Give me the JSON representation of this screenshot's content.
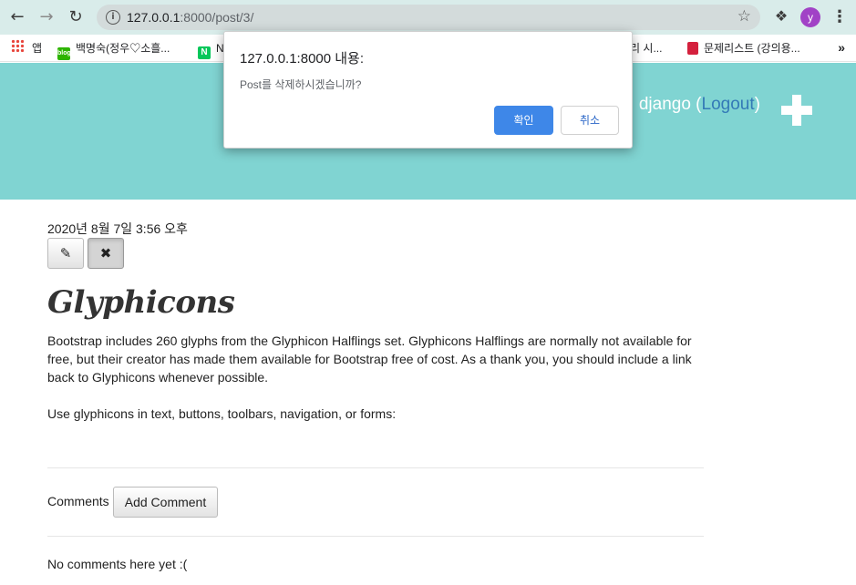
{
  "browser": {
    "url_host": "127.0.0.1",
    "url_rest": ":8000/post/3/",
    "profile_initial": "y",
    "bookmarks": [
      {
        "label": "앱",
        "icon": "apps-grid-icon"
      },
      {
        "label": "백명숙(정우♡소흘...",
        "icon": "blog-icon"
      },
      {
        "label": "N",
        "icon": "naver-icon"
      },
      {
        "label": "관리 시...",
        "icon": ""
      },
      {
        "label": "문제리스트 (강의용...",
        "icon": "book-icon"
      }
    ]
  },
  "header": {
    "greeting": "!, django (",
    "logout": "Logout",
    "greeting_end": ")",
    "accent_color": "#80d4d2"
  },
  "post": {
    "date": "2020년 8월 7일 3:56 오후",
    "title": "Glyphicons",
    "paragraph1": "Bootstrap includes 260 glyphs from the Glyphicon Halflings set. Glyphicons Halflings are normally not available for free, but their creator has made them available for Bootstrap free of cost. As a thank you, you should include a link back to Glyphicons whenever possible.",
    "paragraph2": "Use glyphicons in text, buttons, toolbars, navigation, or forms:"
  },
  "comments": {
    "label": "Comments",
    "add_button": "Add Comment",
    "empty": "No comments here yet :("
  },
  "dialog": {
    "title": "127.0.0.1:8000 내용:",
    "message": "Post를 삭제하시겠습니까?",
    "ok_label": "확인",
    "cancel_label": "취소"
  }
}
